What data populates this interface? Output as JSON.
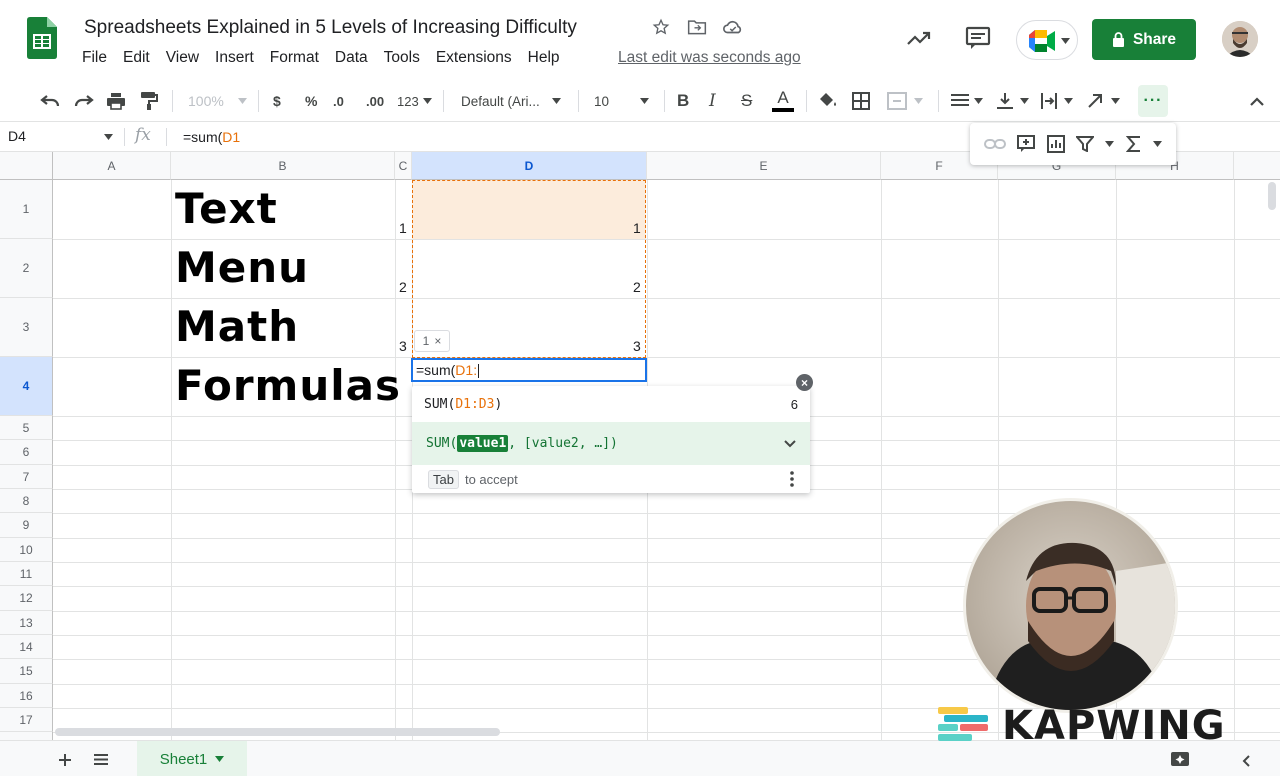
{
  "doc": {
    "title": "Spreadsheets Explained in 5 Levels of Increasing Difficulty",
    "last_edit": "Last edit was seconds ago",
    "share_label": "Share"
  },
  "menu": [
    "File",
    "Edit",
    "View",
    "Insert",
    "Format",
    "Data",
    "Tools",
    "Extensions",
    "Help"
  ],
  "toolbar": {
    "zoom": "100%",
    "currency": "$",
    "percent": "%",
    "dec_decrease": ".0",
    "dec_increase": ".00",
    "number_format": "123",
    "font": "Default (Ari...",
    "font_size": "10",
    "bold": "B",
    "italic": "I",
    "strike": "S",
    "text_color": "A",
    "more": "···"
  },
  "formula_bar": {
    "cell_ref": "D4",
    "fx": "fx",
    "formula_prefix": "=sum(",
    "formula_ref": "D1"
  },
  "columns": [
    "A",
    "B",
    "C",
    "D",
    "E",
    "F",
    "G",
    "H"
  ],
  "rows": [
    "1",
    "2",
    "3",
    "4",
    "5",
    "6",
    "7",
    "8",
    "9",
    "10",
    "11",
    "12",
    "13",
    "14",
    "15",
    "16",
    "17"
  ],
  "cells": {
    "b1": "Text",
    "b2": "Menu",
    "b3": "Math",
    "b4": "Formulas",
    "c1": "1",
    "c2": "2",
    "c3": "3",
    "d1": "1",
    "d2": "2",
    "d3": "3"
  },
  "editor": {
    "input_prefix": "=sum(",
    "input_ref": "D1:",
    "hint_count": "1"
  },
  "autocomplete": {
    "suggestion_fn": "SUM(",
    "suggestion_range": "D1:D3",
    "suggestion_close": ")",
    "suggestion_result": "6",
    "signature_fn": "SUM(",
    "signature_arg": "value1",
    "signature_rest": ", [value2, …])",
    "tab_key": "Tab",
    "tab_hint": "to accept"
  },
  "sheet": {
    "tab_name": "Sheet1"
  },
  "watermark": {
    "brand": "KAPWING"
  },
  "colors": {
    "accent_green": "#188038",
    "range_orange": "#e8710a",
    "selection_blue": "#1a73e8"
  }
}
